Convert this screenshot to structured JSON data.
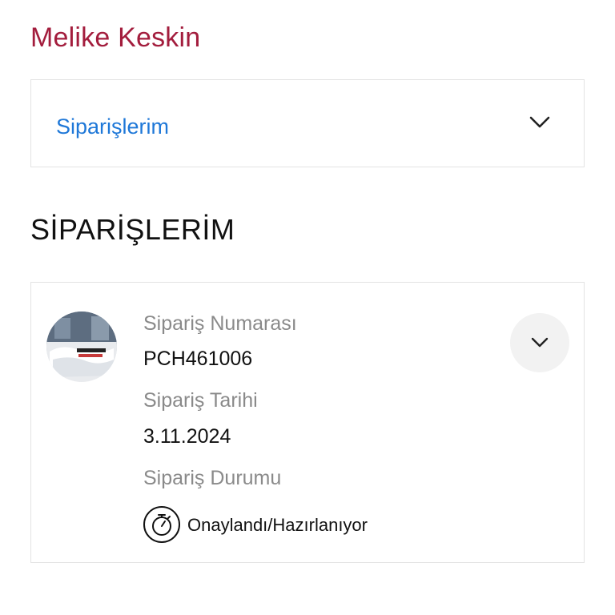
{
  "header": {
    "cut_text": "...",
    "user_name": "Melike Keskin"
  },
  "accordion": {
    "label": "Siparişlerim",
    "icon": "chevron-down-icon"
  },
  "section": {
    "title": "SİPARİŞLERİM"
  },
  "order": {
    "thumbnail": "product-thumbnail",
    "number_label": "Sipariş Numarası",
    "number_value": "PCH461006",
    "date_label": "Sipariş Tarihi",
    "date_value": "3.11.2024",
    "status_label": "Sipariş Durumu",
    "status_value": "Onaylandı/Hazırlanıyor",
    "status_icon": "stopwatch-icon",
    "expand_icon": "chevron-down-icon"
  },
  "colors": {
    "brand": "#a31d3d",
    "link": "#1f78d8",
    "muted": "#8a8a8a",
    "border": "#e3e3e3"
  }
}
